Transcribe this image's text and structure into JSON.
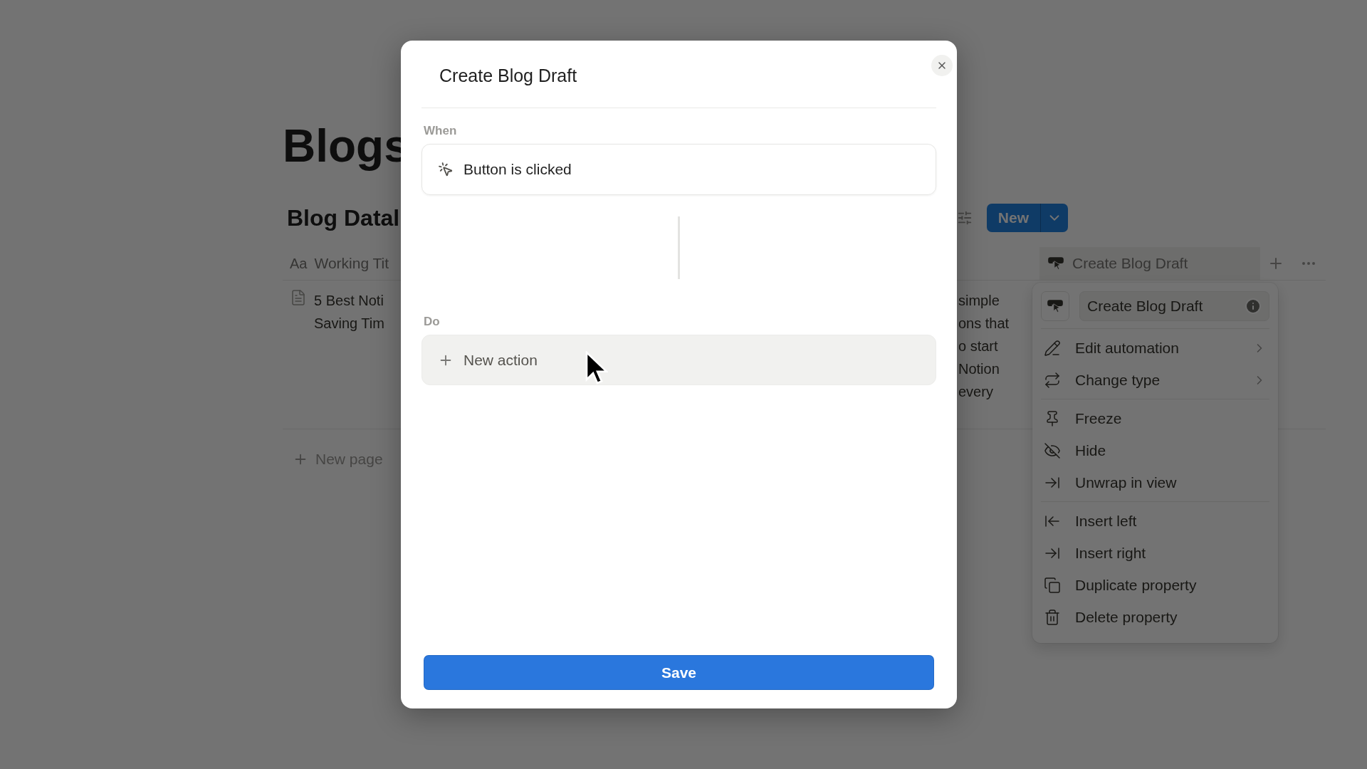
{
  "page": {
    "title": "Blogs",
    "database_title": "Blog Datal",
    "new_button": "New",
    "columns": [
      {
        "kind": "title",
        "type_glyph": "Aa",
        "label": "Working Tit"
      },
      {
        "kind": "button",
        "label": "Create Blog Draft"
      }
    ],
    "rows": [
      {
        "title_lines": [
          "5 Best Noti",
          "Saving Tim"
        ],
        "column_3_lines": [
          "simple",
          "ons that",
          "o start",
          "Notion",
          "every"
        ]
      }
    ],
    "new_page": "New page"
  },
  "menu": {
    "name": "Create Blog Draft",
    "sections": [
      [
        {
          "label": "Edit automation",
          "kind": "pencil",
          "submenu": true
        },
        {
          "label": "Change type",
          "kind": "swap",
          "submenu": true
        }
      ],
      [
        {
          "label": "Freeze",
          "kind": "pin",
          "submenu": false
        },
        {
          "label": "Hide",
          "kind": "hide",
          "submenu": false
        },
        {
          "label": "Unwrap in view",
          "kind": "unwrap",
          "submenu": false
        }
      ],
      [
        {
          "label": "Insert left",
          "kind": "insertleft",
          "submenu": false
        },
        {
          "label": "Insert right",
          "kind": "insertright",
          "submenu": false
        },
        {
          "label": "Duplicate property",
          "kind": "duplicate",
          "submenu": false
        },
        {
          "label": "Delete property",
          "kind": "delete",
          "submenu": false
        }
      ]
    ]
  },
  "modal": {
    "title": "Create Blog Draft",
    "when_label": "When",
    "trigger": "Button is clicked",
    "do_label": "Do",
    "new_action": "New action",
    "save": "Save"
  }
}
